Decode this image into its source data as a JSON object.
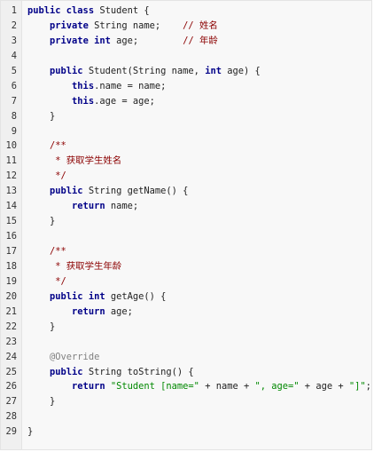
{
  "code": {
    "lines": [
      [
        {
          "t": "public class ",
          "c": "kw"
        },
        {
          "t": "Student {",
          "c": "pl"
        }
      ],
      [
        {
          "t": "    ",
          "c": "pl"
        },
        {
          "t": "private ",
          "c": "kw"
        },
        {
          "t": "String name;    ",
          "c": "pl"
        },
        {
          "t": "// 姓名",
          "c": "cm"
        }
      ],
      [
        {
          "t": "    ",
          "c": "pl"
        },
        {
          "t": "private int ",
          "c": "kw"
        },
        {
          "t": "age;        ",
          "c": "pl"
        },
        {
          "t": "// 年龄",
          "c": "cm"
        }
      ],
      [],
      [
        {
          "t": "    ",
          "c": "pl"
        },
        {
          "t": "public ",
          "c": "kw"
        },
        {
          "t": "Student(String name, ",
          "c": "pl"
        },
        {
          "t": "int ",
          "c": "kw"
        },
        {
          "t": "age) {",
          "c": "pl"
        }
      ],
      [
        {
          "t": "        ",
          "c": "pl"
        },
        {
          "t": "this",
          "c": "kw"
        },
        {
          "t": ".name = name;",
          "c": "pl"
        }
      ],
      [
        {
          "t": "        ",
          "c": "pl"
        },
        {
          "t": "this",
          "c": "kw"
        },
        {
          "t": ".age = age;",
          "c": "pl"
        }
      ],
      [
        {
          "t": "    }",
          "c": "pl"
        }
      ],
      [],
      [
        {
          "t": "    /**",
          "c": "cm"
        }
      ],
      [
        {
          "t": "     * 获取学生姓名",
          "c": "cm"
        }
      ],
      [
        {
          "t": "     */",
          "c": "cm"
        }
      ],
      [
        {
          "t": "    ",
          "c": "pl"
        },
        {
          "t": "public ",
          "c": "kw"
        },
        {
          "t": "String getName() {",
          "c": "pl"
        }
      ],
      [
        {
          "t": "        ",
          "c": "pl"
        },
        {
          "t": "return ",
          "c": "kw"
        },
        {
          "t": "name;",
          "c": "pl"
        }
      ],
      [
        {
          "t": "    }",
          "c": "pl"
        }
      ],
      [],
      [
        {
          "t": "    /**",
          "c": "cm"
        }
      ],
      [
        {
          "t": "     * 获取学生年龄",
          "c": "cm"
        }
      ],
      [
        {
          "t": "     */",
          "c": "cm"
        }
      ],
      [
        {
          "t": "    ",
          "c": "pl"
        },
        {
          "t": "public int ",
          "c": "kw"
        },
        {
          "t": "getAge() {",
          "c": "pl"
        }
      ],
      [
        {
          "t": "        ",
          "c": "pl"
        },
        {
          "t": "return ",
          "c": "kw"
        },
        {
          "t": "age;",
          "c": "pl"
        }
      ],
      [
        {
          "t": "    }",
          "c": "pl"
        }
      ],
      [],
      [
        {
          "t": "    @Override",
          "c": "ann"
        }
      ],
      [
        {
          "t": "    ",
          "c": "pl"
        },
        {
          "t": "public ",
          "c": "kw"
        },
        {
          "t": "String toString() {",
          "c": "pl"
        }
      ],
      [
        {
          "t": "        ",
          "c": "pl"
        },
        {
          "t": "return ",
          "c": "kw"
        },
        {
          "t": "\"Student [name=\"",
          "c": "str"
        },
        {
          "t": " + name + ",
          "c": "pl"
        },
        {
          "t": "\", age=\"",
          "c": "str"
        },
        {
          "t": " + age + ",
          "c": "pl"
        },
        {
          "t": "\"]\"",
          "c": "str"
        },
        {
          "t": ";",
          "c": "pl"
        }
      ],
      [
        {
          "t": "    }",
          "c": "pl"
        }
      ],
      [],
      [
        {
          "t": "}",
          "c": "pl"
        }
      ]
    ]
  }
}
